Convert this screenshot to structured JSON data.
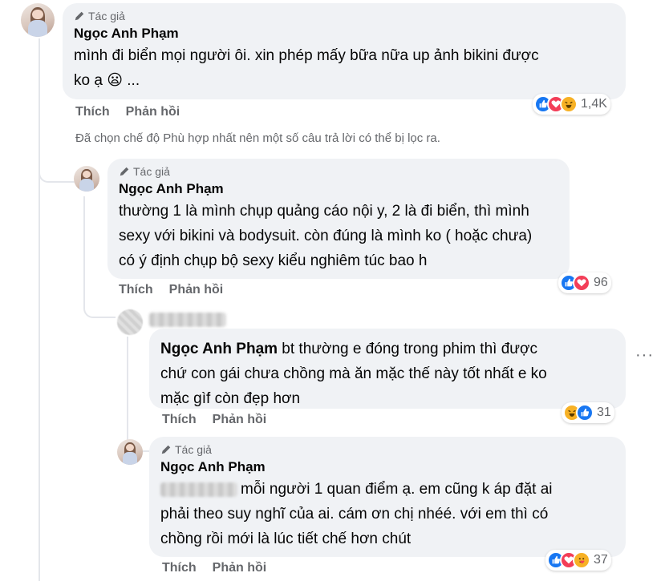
{
  "comments": [
    {
      "badge": "Tác giả",
      "author": "Ngọc Anh Phạm",
      "text_line1": "mình đi biển mọi người ôi. xin phép mấy bữa nữa up ảnh bikini được",
      "text_line2": "ko ạ 😦 ...",
      "like_label": "Thích",
      "reply_label": "Phản hồi",
      "reactions": [
        "like-icon",
        "love-icon",
        "haha-icon"
      ],
      "reaction_count": "1,4K"
    },
    {
      "badge": "Tác giả",
      "author": "Ngọc Anh Phạm",
      "text_line1": "thường 1 là mình chụp quảng cáo nội y, 2 là đi biển, thì mình",
      "text_line2": "sexy với bikini và bodysuit. còn đúng là mình ko ( hoặc chưa)",
      "text_line3": "có ý định chụp bộ sexy kiểu nghiêm túc bao h",
      "like_label": "Thích",
      "reply_label": "Phản hồi",
      "reactions": [
        "like-icon",
        "love-icon"
      ],
      "reaction_count": "96"
    },
    {
      "mention": "Ngọc Anh Phạm",
      "text_line1": " bt thường e đóng trong phim thì được",
      "text_line2": "chứ con gái chưa chồng mà ăn mặc thế này tốt nhất e ko",
      "text_line3": "mặc gìf còn đẹp hơn",
      "like_label": "Thích",
      "reply_label": "Phản hồi",
      "reactions": [
        "haha-icon",
        "like-icon"
      ],
      "reaction_count": "31",
      "more": "···"
    },
    {
      "badge": "Tác giả",
      "author": "Ngọc Anh Phạm",
      "text_line1": "mỗi người 1 quan điểm ạ. em cũng k áp đặt ai",
      "text_line2": "phải theo suy nghĩ của ai. cám ơn chị nhéé. với em thì có",
      "text_line3": "chồng rồi mới là lúc tiết chế hơn chút",
      "like_label": "Thích",
      "reply_label": "Phản hồi",
      "reactions": [
        "like-icon",
        "love-icon",
        "care-icon"
      ],
      "reaction_count": "37"
    }
  ],
  "filter_note": "Đã chọn chế độ Phù hợp nhất nên một số câu trả lời có thể bị lọc ra.",
  "colors": {
    "bubble": "#f0f2f5",
    "secondary_text": "#65676b",
    "like_blue": "#1877f2",
    "love_red": "#f33e58",
    "haha_yellow": "#f7b125"
  }
}
